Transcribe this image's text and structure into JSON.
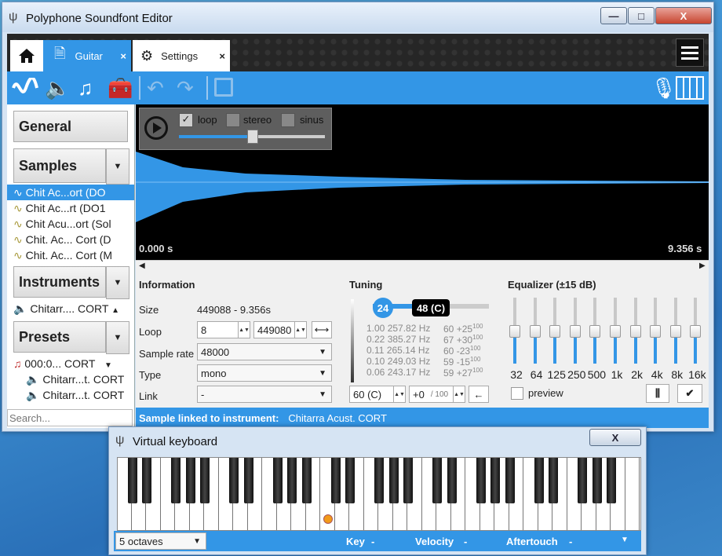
{
  "app": {
    "title": "Polyphone Soundfont Editor"
  },
  "window_controls": {
    "minimize": "—",
    "maximize": "□",
    "close": "X"
  },
  "tabs": [
    {
      "label": "Guitar",
      "close": "×"
    },
    {
      "label": "Settings",
      "close": "×"
    }
  ],
  "toolbar": {
    "icons": [
      "sample-wave-icon",
      "speaker-icon",
      "music-note-icon",
      "toolbox-icon",
      "undo-icon",
      "redo-icon",
      "save-icon"
    ],
    "right_icons": [
      "microphone-icon",
      "piano-icon"
    ]
  },
  "sidebar": {
    "general": "General",
    "samples": "Samples",
    "sample_items": [
      "Chit Ac...ort (DO",
      "Chit Ac...rt (DO1",
      "Chit Acu...ort (Sol",
      "Chit. Ac... Cort (D",
      "Chit. Ac... Cort (M"
    ],
    "instruments": "Instruments",
    "instrument_items": [
      "Chitarr.... CORT"
    ],
    "presets": "Presets",
    "preset_items": [
      "000:0... CORT",
      "Chitarr...t. CORT",
      "Chitarr...t. CORT"
    ],
    "search_placeholder": "Search..."
  },
  "player": {
    "loop": "loop",
    "loop_checked": true,
    "stereo": "stereo",
    "sinus": "sinus",
    "play_icon": "play-icon",
    "volume_fraction": 0.5
  },
  "wave": {
    "start": "0.000 s",
    "end": "9.356 s",
    "accent": "#3396e6"
  },
  "information": {
    "title": "Information",
    "size_label": "Size",
    "size_value": "449088 - 9.356s",
    "loop_label": "Loop",
    "loop_start": "8",
    "loop_end": "449080",
    "rate_label": "Sample rate",
    "rate_value": "48000",
    "type_label": "Type",
    "type_value": "mono",
    "link_label": "Link",
    "link_value": "-"
  },
  "tuning": {
    "title": "Tuning",
    "left_value": "24",
    "right_value": "48 (C)",
    "rows": [
      {
        "ratio": "1.00",
        "freq": "257.82 Hz",
        "note": "60",
        "cents": "+25",
        "den": "100"
      },
      {
        "ratio": "0.22",
        "freq": "385.27 Hz",
        "note": "67",
        "cents": "+30",
        "den": "100"
      },
      {
        "ratio": "0.11",
        "freq": "265.14 Hz",
        "note": "60",
        "cents": "-23",
        "den": "100"
      },
      {
        "ratio": "0.10",
        "freq": "249.03 Hz",
        "note": "59",
        "cents": "-15",
        "den": "100"
      },
      {
        "ratio": "0.06",
        "freq": "243.17 Hz",
        "note": "59",
        "cents": "+27",
        "den": "100"
      }
    ],
    "root_key": "60 (C)",
    "correction": "+0",
    "correction_den": "/ 100"
  },
  "equalizer": {
    "title": "Equalizer (±15 dB)",
    "bands": [
      "32",
      "64",
      "125",
      "250",
      "500",
      "1k",
      "2k",
      "4k",
      "8k",
      "16k"
    ],
    "gains_db": [
      0,
      0,
      0,
      0,
      0,
      0,
      0,
      0,
      0,
      0
    ],
    "preview": "preview"
  },
  "status": {
    "label": "Sample linked to instrument:",
    "value": "Chitarra Acust. CORT"
  },
  "keyboard": {
    "title": "Virtual keyboard",
    "close": "X",
    "octaves": "5 octaves",
    "key_label": "Key",
    "key_value": "-",
    "velocity_label": "Velocity",
    "velocity_value": "-",
    "aftertouch_label": "Aftertouch",
    "aftertouch_value": "-"
  }
}
